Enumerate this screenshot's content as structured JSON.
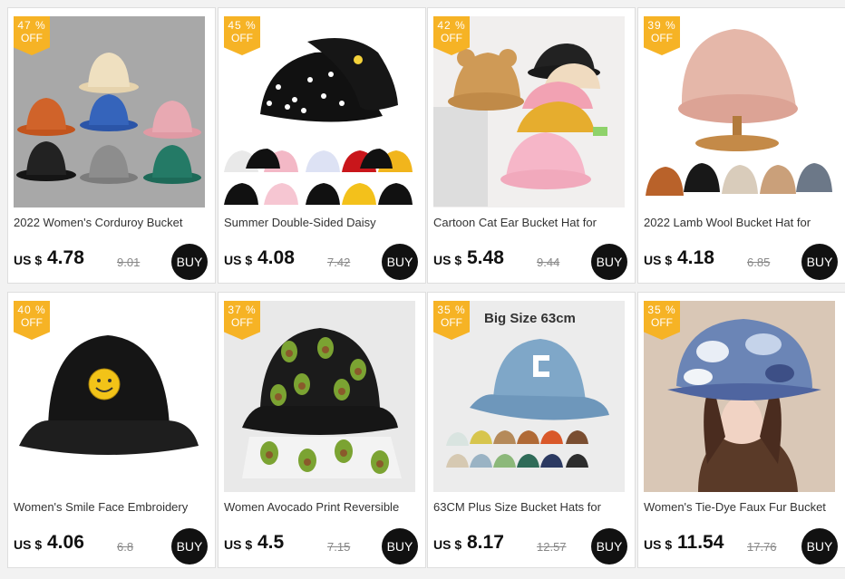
{
  "products": [
    {
      "discount": "47 %",
      "off": "OFF",
      "title": "2022 Women's Corduroy Bucket",
      "currency": "US $",
      "price": "4.78",
      "original": "9.01",
      "buy": "BUY"
    },
    {
      "discount": "45 %",
      "off": "OFF",
      "title": "Summer Double-Sided Daisy",
      "currency": "US $",
      "price": "4.08",
      "original": "7.42",
      "buy": "BUY"
    },
    {
      "discount": "42 %",
      "off": "OFF",
      "title": "Cartoon Cat Ear Bucket Hat for",
      "currency": "US $",
      "price": "5.48",
      "original": "9.44",
      "buy": "BUY"
    },
    {
      "discount": "39 %",
      "off": "OFF",
      "title": "2022 Lamb Wool Bucket Hat for",
      "currency": "US $",
      "price": "4.18",
      "original": "6.85",
      "buy": "BUY"
    },
    {
      "discount": "40 %",
      "off": "OFF",
      "title": "Women's Smile Face Embroidery",
      "currency": "US $",
      "price": "4.06",
      "original": "6.8",
      "buy": "BUY"
    },
    {
      "discount": "37 %",
      "off": "OFF",
      "title": "Women Avocado Print Reversible",
      "currency": "US $",
      "price": "4.5",
      "original": "7.15",
      "buy": "BUY"
    },
    {
      "discount": "35 %",
      "off": "OFF",
      "title": "63CM Plus Size Bucket Hats for",
      "currency": "US $",
      "price": "8.17",
      "original": "12.57",
      "buy": "BUY",
      "image_text": "Big Size  63cm"
    },
    {
      "discount": "35 %",
      "off": "OFF",
      "title": "Women's Tie-Dye Faux Fur Bucket",
      "currency": "US $",
      "price": "11.54",
      "original": "17.76",
      "buy": "BUY"
    }
  ],
  "colors": {
    "badge": "#f6b325",
    "buy_button": "#111111",
    "page_bg": "#f2f2f2"
  }
}
